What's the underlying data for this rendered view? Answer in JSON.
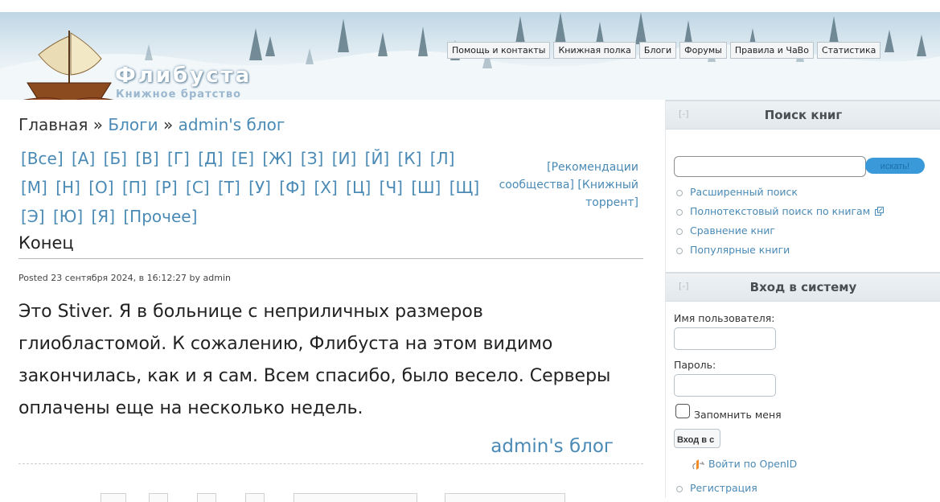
{
  "header": {
    "site_title": "Флибуста",
    "site_subtitle": "Книжное братство",
    "nav": [
      "Помощь и контакты",
      "Книжная полка",
      "Блоги",
      "Форумы",
      "Правила и ЧаВо",
      "Статистика"
    ]
  },
  "breadcrumb": {
    "home": "Главная",
    "sep1": "»",
    "blogs": "Блоги",
    "sep2": "»",
    "current": "admin's блог"
  },
  "alphabet": [
    "[Все]",
    "[А]",
    "[Б]",
    "[В]",
    "[Г]",
    "[Д]",
    "[Е]",
    "[Ж]",
    "[З]",
    "[И]",
    "[Й]",
    "[К]",
    "[Л]",
    "[М]",
    "[Н]",
    "[О]",
    "[П]",
    "[Р]",
    "[С]",
    "[Т]",
    "[У]",
    "[Ф]",
    "[Х]",
    "[Ц]",
    "[Ч]",
    "[Ш]",
    "[Щ]",
    "[Э]",
    "[Ю]",
    "[Я]",
    "[Прочее]"
  ],
  "recommendations": {
    "recs": "[Рекомендации сообщества]",
    "torrent": "[Книжный торрент]"
  },
  "post": {
    "title": "Конец",
    "posted": "Posted 23 сентября 2024, в 16:12:27 by admin",
    "body": "Это Stiver. Я в больнице с неприличных размеров глиобластомой. К сожалению, Флибуста на этом видимо закончилась, как и я сам. Всем спасибо, было весело. Серверы оплачены еще на несколько недель.",
    "blog_link": "admin's блог"
  },
  "sidebar": {
    "search": {
      "toggle": "[-]",
      "title": "Поиск книг",
      "input_value": "",
      "button": "искать!",
      "links": [
        "Расширенный поиск",
        "Полнотекстовый поиск по книгам",
        "Сравнение книг",
        "Популярные книги"
      ]
    },
    "login": {
      "toggle": "[-]",
      "title": "Вход в систему",
      "username_label": "Имя пользователя:",
      "password_label": "Пароль:",
      "remember_label": "Запомнить меня",
      "login_button": "Вход в с",
      "openid_link": "Войти по OpenID",
      "register_link": "Регистрация"
    }
  },
  "colors": {
    "link": "#4a8ab5",
    "search_button": "#3a9ad9",
    "sidebar_head": "#e2e8ec"
  }
}
